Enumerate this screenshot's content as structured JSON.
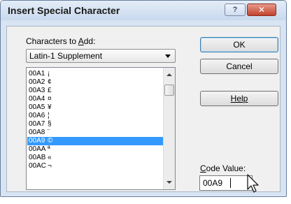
{
  "window": {
    "title": "Insert Special Character",
    "help_glyph": "?",
    "close_glyph": "✕"
  },
  "characters_label": {
    "before": "Characters to ",
    "underlined": "A",
    "after": "dd:"
  },
  "charset_dropdown": {
    "selected": "Latin-1 Supplement"
  },
  "character_list": {
    "selected_index": 8,
    "rows": [
      {
        "code": "00A1",
        "char": "¡"
      },
      {
        "code": "00A2",
        "char": "¢"
      },
      {
        "code": "00A3",
        "char": "£"
      },
      {
        "code": "00A4",
        "char": "¤"
      },
      {
        "code": "00A5",
        "char": "¥"
      },
      {
        "code": "00A6",
        "char": "¦"
      },
      {
        "code": "00A7",
        "char": "§"
      },
      {
        "code": "00A8",
        "char": "¨"
      },
      {
        "code": "00A9",
        "char": "©"
      },
      {
        "code": "00AA",
        "char": "ª"
      },
      {
        "code": "00AB",
        "char": "«"
      },
      {
        "code": "00AC",
        "char": "¬"
      }
    ]
  },
  "buttons": {
    "ok": "OK",
    "cancel": "Cancel",
    "help": "Help"
  },
  "code_value": {
    "label_underlined": "C",
    "label_rest": "ode Value:",
    "value": "00A9"
  },
  "icons": {
    "scroll_up": "scroll-up-arrow-icon",
    "scroll_down": "scroll-down-arrow-icon",
    "cursor": "mouse-pointer-icon",
    "dropdown": "chevron-down-icon"
  }
}
